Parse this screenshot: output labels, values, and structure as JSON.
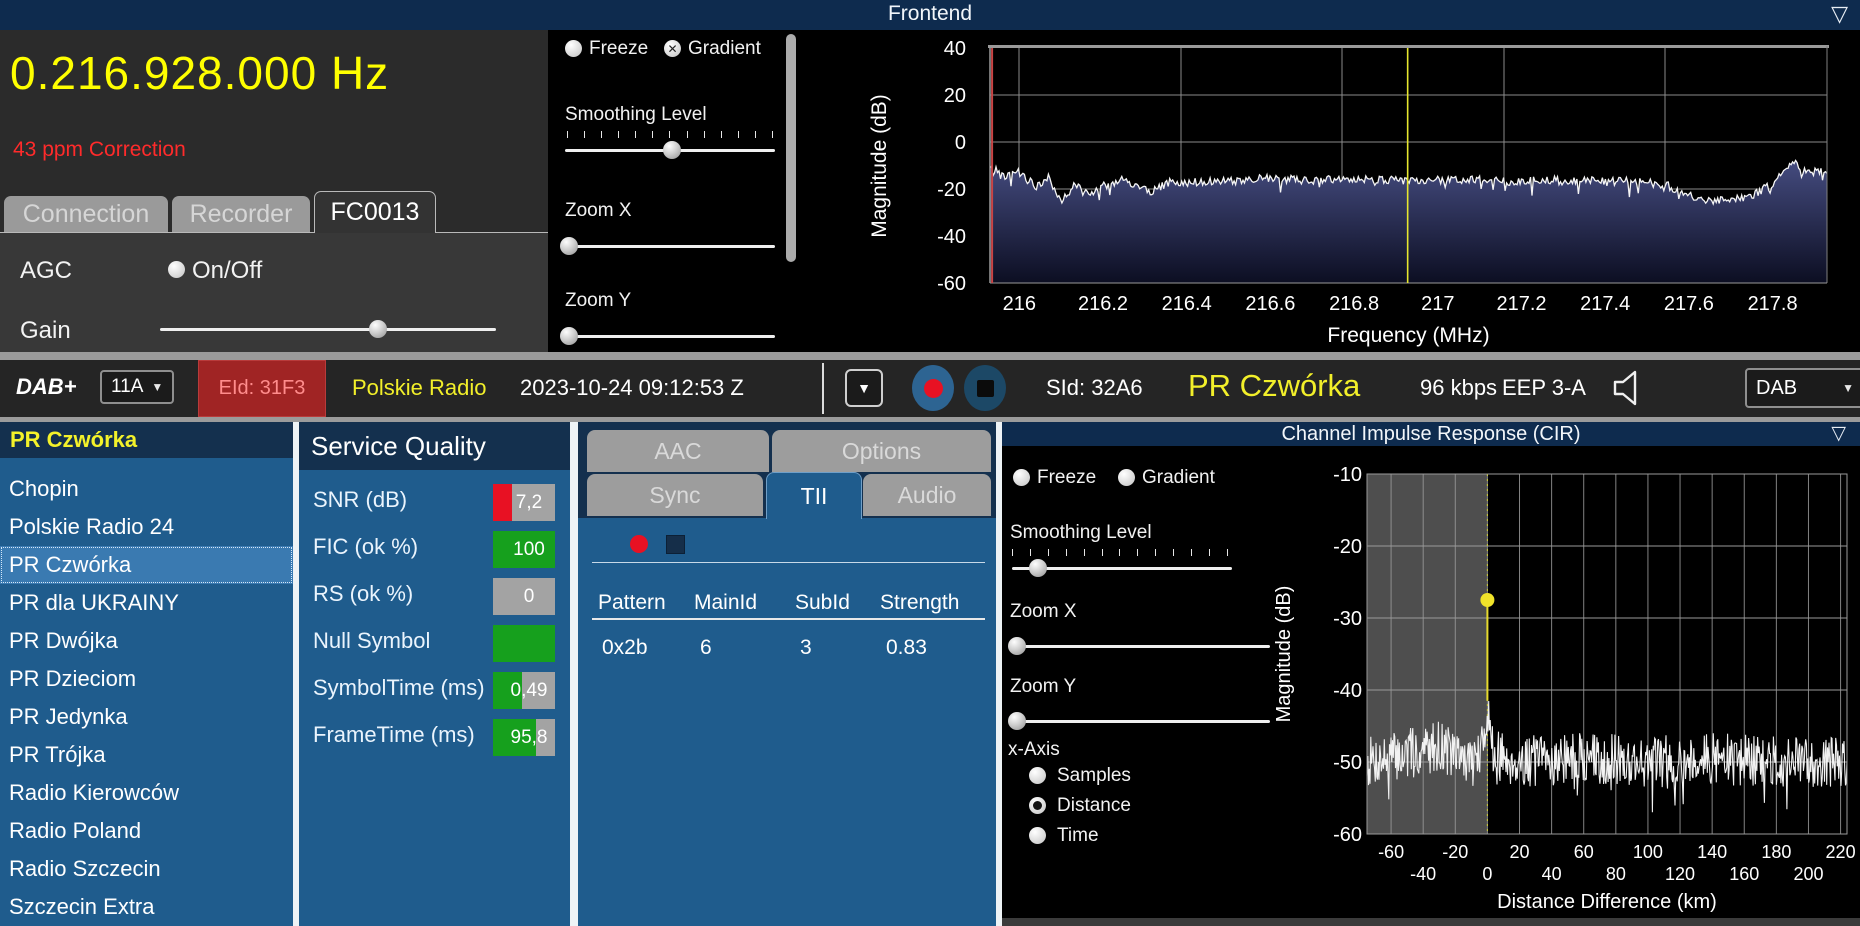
{
  "window": {
    "title": "Frontend",
    "collapse_icon": "▽"
  },
  "frontend": {
    "frequency": "0.216.928.000 Hz",
    "correction": "43 ppm Correction",
    "tabs": [
      {
        "label": "Connection"
      },
      {
        "label": "Recorder"
      },
      {
        "label": "FC0013"
      }
    ],
    "active_tab": "FC0013",
    "agc": {
      "label": "AGC",
      "toggle": "On/Off"
    },
    "gain": {
      "label": "Gain",
      "pct": 65
    },
    "controls": {
      "freeze": "Freeze",
      "gradient": "Gradient",
      "gradient_checked": true,
      "smoothing": {
        "label": "Smoothing Level",
        "pct": 51
      },
      "zoom_x": {
        "label": "Zoom X",
        "pct": 2
      },
      "zoom_y": {
        "label": "Zoom Y",
        "pct": 2
      }
    }
  },
  "status_bar": {
    "mode": "DAB+",
    "channel_select": {
      "value": "11A"
    },
    "ensemble_id": "EId: 31F3",
    "ensemble_name": "Polskie Radio",
    "datetime": "2023-10-24  09:12:53 Z",
    "service_id": "SId: 32A6",
    "service_name": "PR Czwórka",
    "bitrate": "96 kbps",
    "protection": "EEP 3-A",
    "output_select": {
      "value": "DAB"
    },
    "icons": {
      "dropdown": "▼",
      "record": "record-icon",
      "stop": "stop-icon",
      "speaker": "speaker-icon"
    }
  },
  "service_list": {
    "header": "PR Czwórka",
    "selected": "PR Czwórka",
    "items": [
      "Chopin",
      "Polskie Radio 24",
      "PR Czwórka",
      "PR dla UKRAINY",
      "PR Dwójka",
      "PR Dzieciom",
      "PR Jedynka",
      "PR Trójka",
      "Radio Kierowców",
      "Radio Poland",
      "Radio Szczecin",
      "Szczecin Extra"
    ]
  },
  "service_quality": {
    "header": "Service Quality",
    "rows": [
      {
        "label": "SNR (dB)",
        "value": "7,2",
        "segments": [
          [
            "#e81123",
            30
          ],
          [
            "#a3a3a3",
            70
          ]
        ]
      },
      {
        "label": "FIC (ok %)",
        "value": "100",
        "segments": [
          [
            "#16a01d",
            100
          ]
        ]
      },
      {
        "label": "RS (ok %)",
        "value": "0",
        "segments": [
          [
            "#a3a3a3",
            100
          ]
        ]
      },
      {
        "label": "Null Symbol",
        "value": "",
        "segments": [
          [
            "#16a01d",
            100
          ]
        ]
      },
      {
        "label": "SymbolTime (ms)",
        "value": "0,49",
        "segments": [
          [
            "#16a01d",
            46
          ],
          [
            "#a3a3a3",
            54
          ]
        ]
      },
      {
        "label": "FrameTime (ms)",
        "value": "95,8",
        "segments": [
          [
            "#16a01d",
            70
          ],
          [
            "#a3a3a3",
            30
          ]
        ]
      }
    ]
  },
  "tii": {
    "tabs_top": [
      "AAC",
      "Options"
    ],
    "tabs": [
      "Sync",
      "TII",
      "Audio"
    ],
    "active_tab": "TII",
    "table": {
      "headers": [
        "Pattern",
        "MainId",
        "SubId",
        "Strength"
      ],
      "rows": [
        [
          "0x2b",
          "6",
          "3",
          "0.83"
        ]
      ]
    }
  },
  "cir": {
    "title": "Channel Impulse Response (CIR)",
    "collapse_icon": "▽",
    "controls": {
      "freeze": "Freeze",
      "gradient": "Gradient",
      "smoothing": {
        "label": "Smoothing Level",
        "pct": 12
      },
      "zoom_x": {
        "label": "Zoom X",
        "pct": 2
      },
      "zoom_y": {
        "label": "Zoom Y",
        "pct": 2
      }
    },
    "x_axis": {
      "label": "x-Axis",
      "options": [
        {
          "label": "Samples",
          "selected": false
        },
        {
          "label": "Distance",
          "selected": true
        },
        {
          "label": "Time",
          "selected": false
        }
      ]
    }
  },
  "colors": {
    "accent_yellow": "#ffff00",
    "status_yellow": "#f2ef2a",
    "alert_red": "#ff2b2b",
    "eid_bg": "#a02424",
    "eid_text": "#ff8c8c",
    "panel_blue": "#1f5c8d",
    "header_navy": "#14304e",
    "titlebar_navy": "#0e2b4e",
    "green": "#16a01d",
    "record_red": "#e81123",
    "record_btn_blue": "#2d6492",
    "stop_btn_blue": "#1c4866"
  },
  "chart_data": [
    {
      "type": "line",
      "title": "Frontend spectrum",
      "xlabel": "Frequency (MHz)",
      "ylabel": "Magnitude (dB)",
      "xlim": [
        215.93,
        217.93
      ],
      "ylim": [
        -60,
        40
      ],
      "xticks": [
        216,
        216.2,
        216.4,
        216.6,
        216.8,
        217,
        217.2,
        217.4,
        217.6,
        217.8
      ],
      "yticks": [
        40,
        20,
        0,
        -20,
        -40,
        -60
      ],
      "grid": true,
      "tuned_marker_mhz": 216.928,
      "left_edge_marker_mhz": 215.935,
      "noise_db": 1.8,
      "fill": true,
      "envelope": [
        [
          215.93,
          -10
        ],
        [
          215.96,
          -15
        ],
        [
          216.0,
          -13
        ],
        [
          216.04,
          -19
        ],
        [
          216.07,
          -15
        ],
        [
          216.1,
          -26
        ],
        [
          216.13,
          -18
        ],
        [
          216.16,
          -22
        ],
        [
          216.2,
          -19
        ],
        [
          216.24,
          -16
        ],
        [
          216.28,
          -19
        ],
        [
          216.32,
          -21
        ],
        [
          216.36,
          -17
        ],
        [
          216.4,
          -17.5
        ],
        [
          216.45,
          -16.5
        ],
        [
          216.5,
          -17
        ],
        [
          216.55,
          -16
        ],
        [
          216.6,
          -15.5
        ],
        [
          216.65,
          -16
        ],
        [
          216.7,
          -16.5
        ],
        [
          216.75,
          -16
        ],
        [
          216.8,
          -16.5
        ],
        [
          216.85,
          -16
        ],
        [
          216.9,
          -16.5
        ],
        [
          216.95,
          -16.5
        ],
        [
          217.0,
          -16
        ],
        [
          217.05,
          -16.5
        ],
        [
          217.1,
          -16
        ],
        [
          217.15,
          -16.5
        ],
        [
          217.2,
          -17
        ],
        [
          217.25,
          -16
        ],
        [
          217.3,
          -16.5
        ],
        [
          217.35,
          -16
        ],
        [
          217.4,
          -17
        ],
        [
          217.45,
          -16.5
        ],
        [
          217.5,
          -17
        ],
        [
          217.55,
          -18.5
        ],
        [
          217.6,
          -23
        ],
        [
          217.65,
          -25.5
        ],
        [
          217.7,
          -24
        ],
        [
          217.75,
          -23
        ],
        [
          217.8,
          -18
        ],
        [
          217.83,
          -11
        ],
        [
          217.85,
          -8.5
        ],
        [
          217.88,
          -13
        ],
        [
          217.93,
          -12
        ]
      ]
    },
    {
      "type": "line",
      "title": "Channel Impulse Response (CIR)",
      "xlabel": "Distance Difference (km)",
      "ylabel": "Magnitude (dB)",
      "xlim": [
        -75,
        224
      ],
      "ylim": [
        -60,
        -10
      ],
      "xticks": [
        -60,
        -40,
        -20,
        0,
        20,
        40,
        60,
        80,
        100,
        120,
        140,
        160,
        180,
        200,
        220
      ],
      "yticks": [
        -10,
        -20,
        -30,
        -40,
        -50,
        -60
      ],
      "grid": true,
      "gray_region": [
        -75,
        0
      ],
      "peak_marker": {
        "x": 0,
        "y": -27.5
      },
      "noise_db": 3.6,
      "envelope": [
        [
          -75,
          -50
        ],
        [
          -40,
          -48.5
        ],
        [
          -30,
          -47.5
        ],
        [
          -20,
          -49
        ],
        [
          -10,
          -50
        ],
        [
          -4,
          -49
        ],
        [
          -2,
          -47
        ],
        [
          -1,
          -44
        ],
        [
          0,
          -41.5
        ],
        [
          1,
          -44
        ],
        [
          2,
          -47
        ],
        [
          4,
          -49
        ],
        [
          20,
          -50
        ],
        [
          60,
          -49.5
        ],
        [
          100,
          -50
        ],
        [
          140,
          -49.5
        ],
        [
          180,
          -50
        ],
        [
          224,
          -50
        ]
      ]
    }
  ]
}
